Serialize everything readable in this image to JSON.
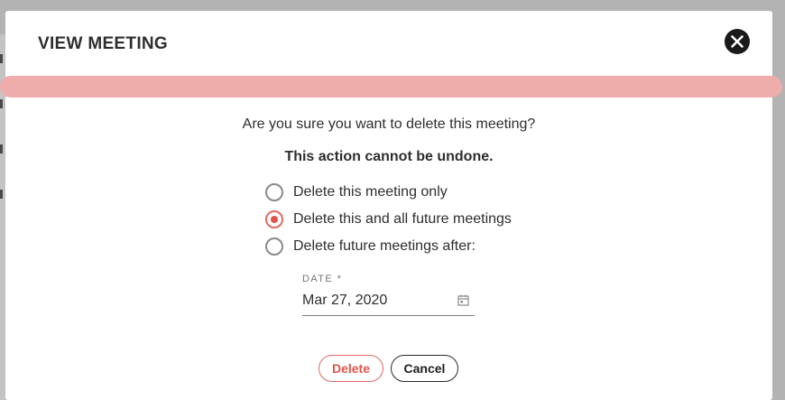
{
  "modal": {
    "title": "VIEW MEETING",
    "question": "Are you sure you want to delete this meeting?",
    "warning": "This action cannot be undone."
  },
  "options": [
    {
      "label": "Delete this meeting only",
      "checked": false
    },
    {
      "label": "Delete this and all future meetings",
      "checked": true
    },
    {
      "label": "Delete future meetings after:",
      "checked": false
    }
  ],
  "date_field": {
    "label": "DATE *",
    "value": "Mar 27, 2020"
  },
  "buttons": {
    "delete_label": "Delete",
    "cancel_label": "Cancel"
  },
  "icons": {
    "close": "close-icon",
    "calendar": "calendar-icon"
  },
  "colors": {
    "accent": "#e0544a",
    "warning_bar": "#eeacaa"
  }
}
